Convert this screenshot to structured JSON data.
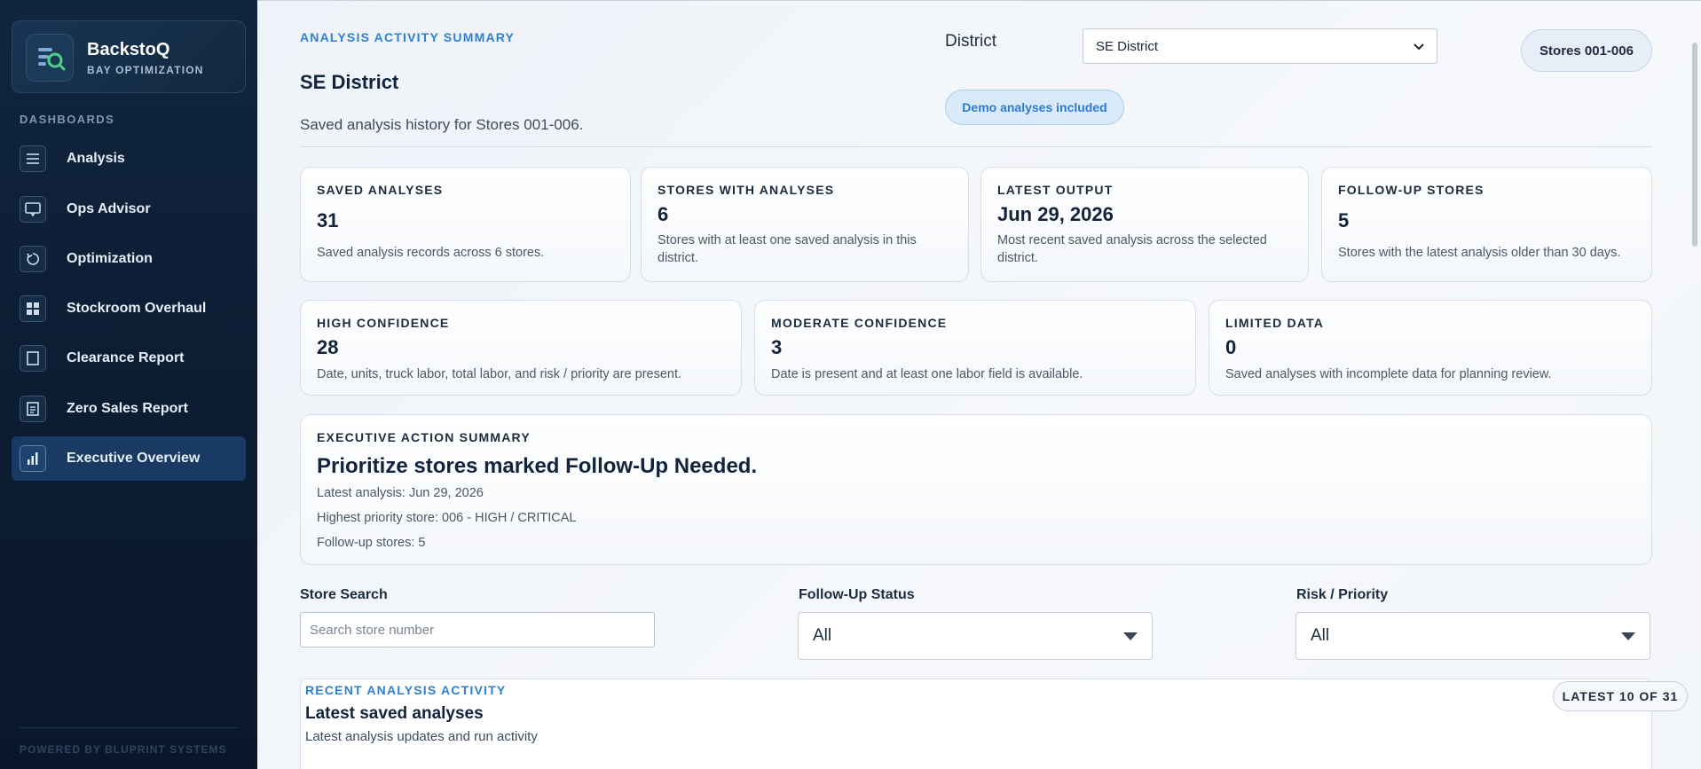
{
  "brand": {
    "title": "BackstoQ",
    "subtitle": "BAY OPTIMIZATION"
  },
  "sidebar": {
    "section_label": "DASHBOARDS",
    "items": [
      {
        "label": "Analysis",
        "icon": "menu-lines-icon",
        "active": false
      },
      {
        "label": "Ops Advisor",
        "icon": "monitor-chat-icon",
        "active": false
      },
      {
        "label": "Optimization",
        "icon": "refresh-arrow-icon",
        "active": false
      },
      {
        "label": "Stockroom Overhaul",
        "icon": "grid-icon",
        "active": false
      },
      {
        "label": "Clearance Report",
        "icon": "page-icon",
        "active": false
      },
      {
        "label": "Zero Sales Report",
        "icon": "document-lines-icon",
        "active": false
      },
      {
        "label": "Executive Overview",
        "icon": "bar-chart-icon",
        "active": true
      }
    ],
    "footer": "POWERED BY BLUPRINT SYSTEMS"
  },
  "header": {
    "eyebrow": "ANALYSIS ACTIVITY SUMMARY",
    "title": "SE District",
    "subtitle": "Saved analysis history for Stores 001-006.",
    "district_label": "District",
    "district_value": "SE District",
    "stores_pill": "Stores 001-006",
    "demo_pill": "Demo analyses included"
  },
  "stats": [
    {
      "label": "SAVED ANALYSES",
      "value": "31",
      "desc": "Saved analysis records across 6 stores."
    },
    {
      "label": "STORES WITH ANALYSES",
      "value": "6",
      "desc": "Stores with at least one saved analysis in this district."
    },
    {
      "label": "LATEST OUTPUT",
      "value": "Jun 29, 2026",
      "desc": "Most recent saved analysis across the selected district."
    },
    {
      "label": "FOLLOW-UP STORES",
      "value": "5",
      "desc": "Stores with the latest analysis older than 30 days."
    }
  ],
  "confidence": [
    {
      "label": "HIGH CONFIDENCE",
      "value": "28",
      "desc": "Date, units, truck labor, total labor, and risk / priority are present."
    },
    {
      "label": "MODERATE CONFIDENCE",
      "value": "3",
      "desc": "Date is present and at least one labor field is available."
    },
    {
      "label": "LIMITED DATA",
      "value": "0",
      "desc": "Saved analyses with incomplete data for planning review."
    }
  ],
  "executive": {
    "label": "EXECUTIVE ACTION SUMMARY",
    "headline": "Prioritize stores marked Follow-Up Needed.",
    "lines": [
      "Latest analysis: Jun 29, 2026",
      "Highest priority store: 006 - HIGH / CRITICAL",
      "Follow-up stores: 5"
    ]
  },
  "filters": {
    "search_label": "Store Search",
    "search_placeholder": "Search store number",
    "followup_label": "Follow-Up Status",
    "followup_value": "All",
    "risk_label": "Risk / Priority",
    "risk_value": "All"
  },
  "recent": {
    "eyebrow": "RECENT ANALYSIS ACTIVITY",
    "title": "Latest saved analyses",
    "subtitle": "Latest analysis updates and run activity",
    "pill": "LATEST 10 OF 31"
  },
  "colors": {
    "accent": "#2f7fd6",
    "sidebar_bg": "#0c1d33",
    "active_nav": "#183a63",
    "logo_green": "#4cd28a"
  }
}
